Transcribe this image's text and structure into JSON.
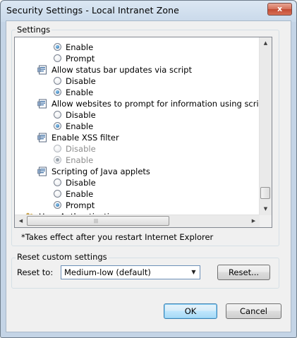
{
  "window": {
    "title": "Security Settings - Local Intranet Zone",
    "close_glyph": "x"
  },
  "settings": {
    "group_label": "Settings",
    "items": [
      {
        "kind": "radio",
        "label": "Enable",
        "checked": true,
        "disabled": false
      },
      {
        "kind": "radio",
        "label": "Prompt",
        "checked": false,
        "disabled": false
      },
      {
        "kind": "header",
        "label": "Allow status bar updates via script",
        "icon": "script-settings-icon"
      },
      {
        "kind": "radio",
        "label": "Disable",
        "checked": false,
        "disabled": false
      },
      {
        "kind": "radio",
        "label": "Enable",
        "checked": true,
        "disabled": false
      },
      {
        "kind": "header",
        "label": "Allow websites to prompt for information using scripted windo",
        "icon": "script-settings-icon"
      },
      {
        "kind": "radio",
        "label": "Disable",
        "checked": false,
        "disabled": false
      },
      {
        "kind": "radio",
        "label": "Enable",
        "checked": true,
        "disabled": false
      },
      {
        "kind": "header",
        "label": "Enable XSS filter",
        "icon": "script-settings-icon"
      },
      {
        "kind": "radio",
        "label": "Disable",
        "checked": false,
        "disabled": true
      },
      {
        "kind": "radio",
        "label": "Enable",
        "checked": true,
        "disabled": true
      },
      {
        "kind": "header",
        "label": "Scripting of Java applets",
        "icon": "script-settings-icon"
      },
      {
        "kind": "radio",
        "label": "Disable",
        "checked": false,
        "disabled": false
      },
      {
        "kind": "radio",
        "label": "Enable",
        "checked": false,
        "disabled": false
      },
      {
        "kind": "radio",
        "label": "Prompt",
        "checked": true,
        "disabled": false
      },
      {
        "kind": "header",
        "label": "User Authentication",
        "icon": "users-icon"
      }
    ],
    "footnote": "*Takes effect after you restart Internet Explorer"
  },
  "reset": {
    "group_label": "Reset custom settings",
    "reset_to_label": "Reset to:",
    "selected": "Medium-low (default)",
    "reset_button": "Reset..."
  },
  "buttons": {
    "ok": "OK",
    "cancel": "Cancel"
  },
  "colors": {
    "default_button_border": "#3c7fb1",
    "radio_dot": "#1c5e9c",
    "disabled_text": "#8d8d8d"
  }
}
